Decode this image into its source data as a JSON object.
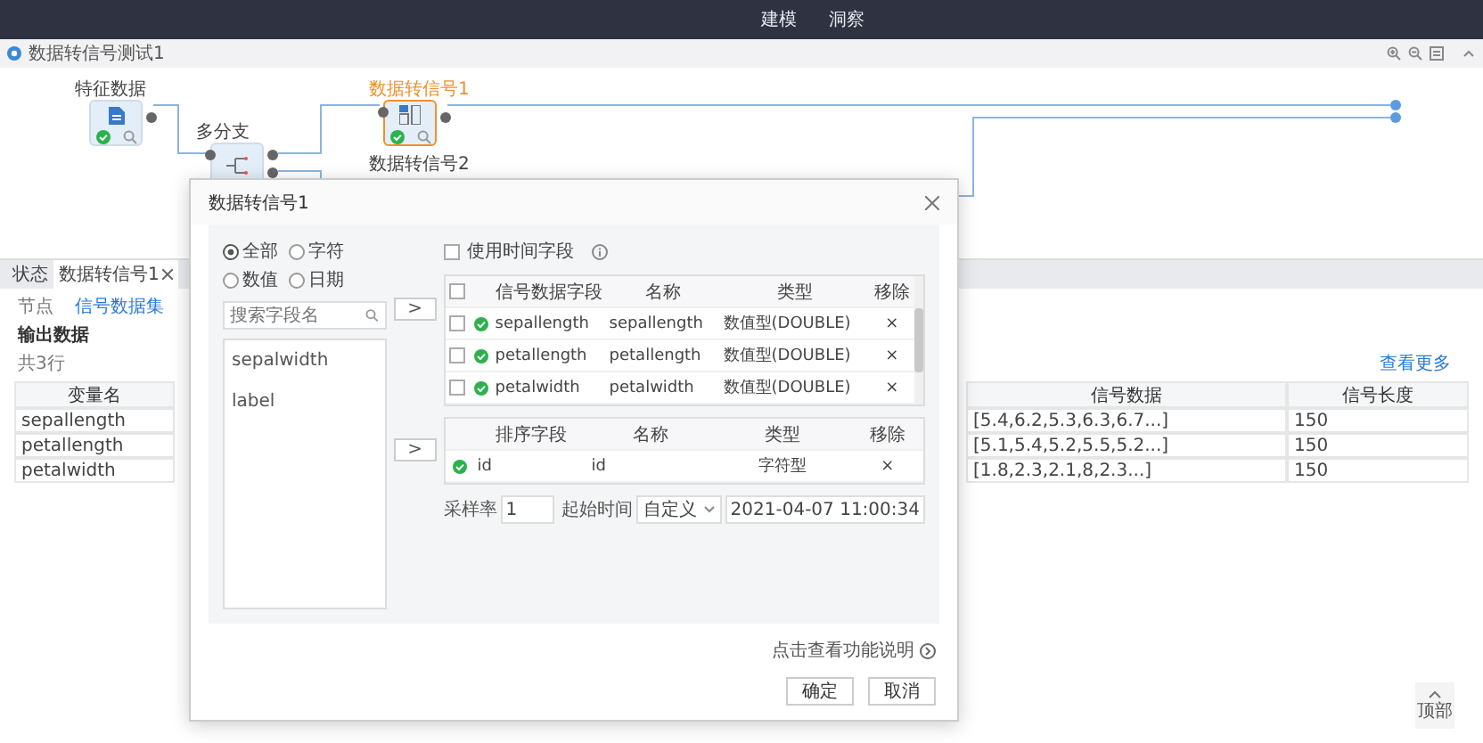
{
  "top_nav": [
    "建模",
    "洞察"
  ],
  "toolbar": {
    "title": "数据转信号测试1"
  },
  "canvas": {
    "nodes": [
      {
        "label": "特征数据",
        "kind": "source",
        "selected": false
      },
      {
        "label": "多分支",
        "kind": "split",
        "selected": false
      },
      {
        "label": "数据转信号1",
        "kind": "convert",
        "selected": true
      },
      {
        "label": "数据转信号2",
        "kind": "label_only",
        "selected": false
      }
    ]
  },
  "bottom_panel": {
    "tabs": [
      {
        "label": "状态",
        "selected": false,
        "closable": false
      },
      {
        "label": "数据转信号1",
        "selected": true,
        "closable": true
      }
    ],
    "subtabs": [
      {
        "label": "节点",
        "selected": false
      },
      {
        "label": "信号数据集",
        "selected": true
      }
    ],
    "heading": "输出数据",
    "row_count": "共3行",
    "more_link": "查看更多",
    "columns": [
      "变量名",
      "信号数据",
      "信号长度"
    ],
    "rows": [
      {
        "name": "sepallength",
        "data": "[5.4,6.2,5.3,6.3,6.7...]",
        "length": "150"
      },
      {
        "name": "petallength",
        "data": "[5.1,5.4,5.2,5.5,5.2...]",
        "length": "150"
      },
      {
        "name": "petalwidth",
        "data": "[1.8,2.3,2.1,8,2.3...]",
        "length": "150"
      }
    ]
  },
  "dialog": {
    "title": "数据转信号1",
    "radios": [
      {
        "label": "全部",
        "selected": true
      },
      {
        "label": "字符",
        "selected": false
      },
      {
        "label": "数值",
        "selected": false
      },
      {
        "label": "日期",
        "selected": false
      }
    ],
    "search": {
      "placeholder": "搜索字段名"
    },
    "fields": [
      "sepalwidth",
      "label"
    ],
    "move_buttons": [
      ">",
      ">"
    ],
    "use_time_field": {
      "label": "使用时间字段",
      "checked": false
    },
    "signal_table": {
      "all_checked": false,
      "columns": [
        "信号数据字段",
        "名称",
        "类型",
        "移除"
      ],
      "rows": [
        {
          "field": "sepallength",
          "name": "sepallength",
          "type": "数值型(DOUBLE)",
          "remove": "×",
          "checked": false
        },
        {
          "field": "petallength",
          "name": "petallength",
          "type": "数值型(DOUBLE)",
          "remove": "×",
          "checked": false
        },
        {
          "field": "petalwidth",
          "name": "petalwidth",
          "type": "数值型(DOUBLE)",
          "remove": "×",
          "checked": false
        }
      ]
    },
    "sort_table": {
      "columns": [
        "排序字段",
        "名称",
        "类型",
        "移除"
      ],
      "rows": [
        {
          "field": "id",
          "name": "id",
          "type": "字符型",
          "remove": "×"
        }
      ]
    },
    "sample_rate": {
      "label": "采样率",
      "value": "1"
    },
    "start_time": {
      "label": "起始时间",
      "mode": "自定义",
      "value": "2021-04-07 11:00:34"
    },
    "help_link": "点击查看功能说明",
    "buttons": [
      "确定",
      "取消"
    ]
  },
  "scroll_top": "顶部"
}
